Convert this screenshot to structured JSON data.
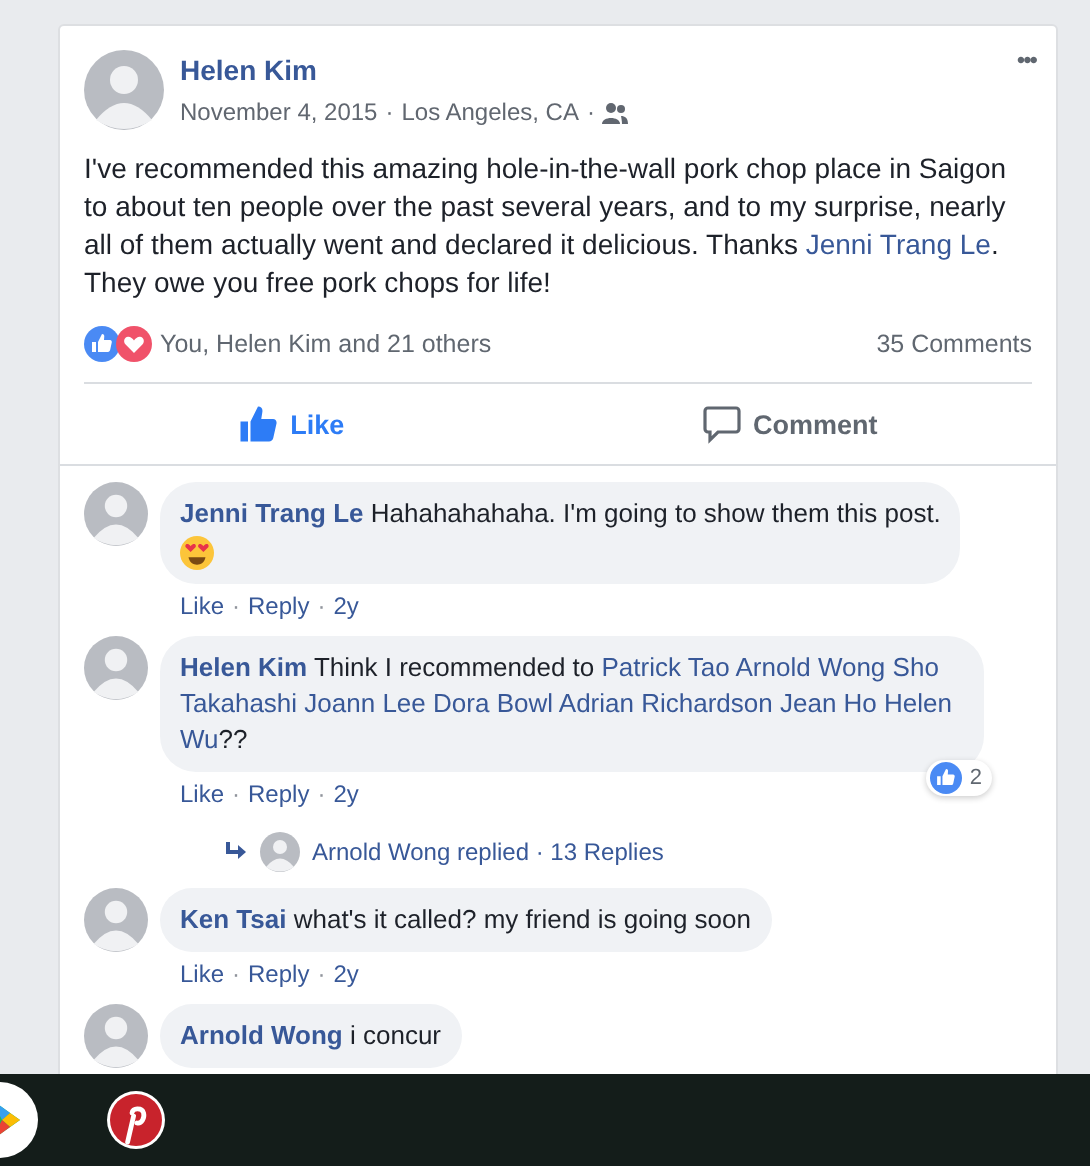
{
  "post": {
    "author": "Helen Kim",
    "date": "November 4, 2015",
    "location": "Los Angeles, CA",
    "separator": "·",
    "more": "•••",
    "body": [
      {
        "kind": "text",
        "text": "I've recommended this amazing hole-in-the-wall pork chop place in Saigon to about ten people over the past several years, and to my surprise, nearly all of them actually went and declared it delicious. Thanks "
      },
      {
        "kind": "link",
        "text": "Jenni Trang Le"
      },
      {
        "kind": "text",
        "text": ". They owe you free pork chops for life!"
      }
    ],
    "reactions_summary": "You, Helen Kim and 21 others",
    "comments_count": "35 Comments",
    "actions": [
      {
        "kind": "like",
        "label": "Like",
        "selected": true
      },
      {
        "kind": "comment",
        "label": "Comment",
        "selected": false
      }
    ]
  },
  "comments": [
    {
      "author": "Jenni Trang Le",
      "emoji": true,
      "segments": [
        {
          "kind": "text",
          "text": "Hahahahahaha. I'm going to show them this post."
        }
      ],
      "meta": [
        "Like",
        "Reply",
        "2y"
      ]
    },
    {
      "author": "Helen Kim",
      "segments": [
        {
          "kind": "text",
          "text": "Think I recommended to "
        },
        {
          "kind": "link",
          "text": "Patrick Tao"
        },
        {
          "kind": "link",
          "text": "Arnold Wong"
        },
        {
          "kind": "link",
          "text": "Sho"
        },
        {
          "kind": "link",
          "text": "Takahashi"
        },
        {
          "kind": "link",
          "text": "Joann Lee"
        },
        {
          "kind": "link",
          "text": "Dora Bowl"
        },
        {
          "kind": "link",
          "text": "Adrian Richardson"
        },
        {
          "kind": "link",
          "text": "Jean Ho"
        },
        {
          "kind": "link",
          "text": "Helen"
        },
        {
          "kind": "link",
          "text": "Wu"
        },
        {
          "kind": "text",
          "text": "??"
        }
      ],
      "meta": [
        "Like",
        "Reply",
        "2y"
      ],
      "like_count": "2",
      "replies": "Arnold Wong replied · 13 Replies"
    },
    {
      "author": "Ken Tsai",
      "segments": [
        {
          "kind": "text",
          "text": "what's it called? my friend is going soon"
        }
      ],
      "meta": [
        "Like",
        "Reply",
        "2y"
      ]
    },
    {
      "author": "Arnold Wong",
      "segments": [
        {
          "kind": "text",
          "text": "i concur"
        }
      ]
    }
  ],
  "dock": [
    {
      "kind": "play"
    },
    {
      "kind": "pin"
    }
  ]
}
